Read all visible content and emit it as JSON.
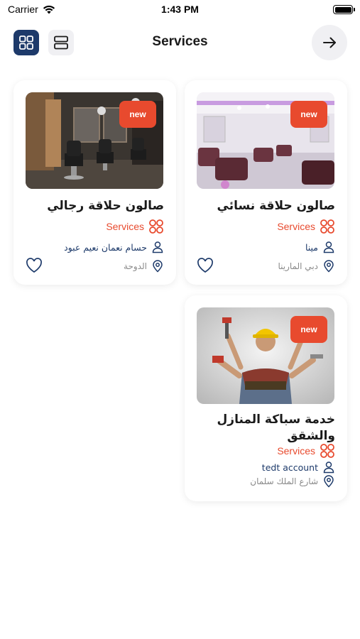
{
  "status_bar": {
    "carrier": "Carrier",
    "time": "1:43 PM"
  },
  "header": {
    "title": "Services"
  },
  "colors": {
    "accent": "#e84a2e",
    "navy": "#1d3a6a",
    "muted": "#8a8a8a"
  },
  "cards": [
    {
      "badge": "new",
      "title": "صالون حلاقة رجالي",
      "category": "Services",
      "owner": "حسام نعمان نعيم عبود",
      "location": "الدوحة",
      "image_icon": "barbershop-photo"
    },
    {
      "badge": "new",
      "title": "صالون حلاقة نسائي",
      "category": "Services",
      "owner": "مينا",
      "location": "دبي المارينا",
      "image_icon": "hair-salon-photo"
    },
    {
      "badge": "new",
      "title": "خدمة سباكة المنازل والشقق",
      "category": "Services",
      "owner": "tedt account",
      "location": "شارع الملك سلمان",
      "image_icon": "plumber-photo"
    }
  ]
}
